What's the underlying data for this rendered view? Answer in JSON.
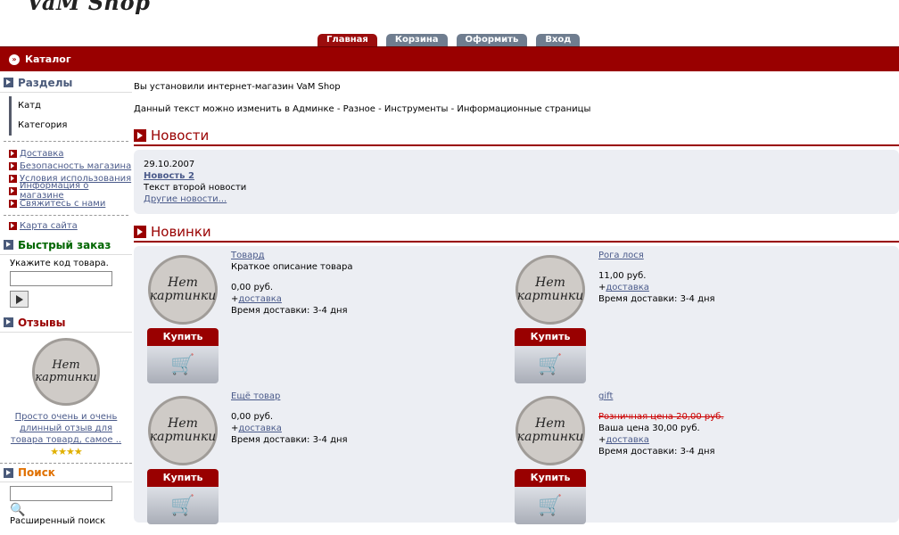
{
  "logo": "VaM Shop",
  "tabs": [
    {
      "label": "Главная",
      "active": true
    },
    {
      "label": "Корзина",
      "active": false
    },
    {
      "label": "Оформить",
      "active": false
    },
    {
      "label": "Вход",
      "active": false
    }
  ],
  "topbar": {
    "catalog": "Каталог"
  },
  "sidebar": {
    "sections_title": "Разделы",
    "sections": [
      "Катд",
      "Категория"
    ],
    "info_links": [
      "Доставка",
      "Безопасность магазина",
      "Условия использования",
      "Информация о магазине",
      "Свяжитесь с нами"
    ],
    "sitemap": "Карта сайта",
    "quick_order_title": "Быстрый заказ",
    "quick_order_label": "Укажите код товара.",
    "reviews_title": "Отзывы",
    "review_text": "Просто очень и очень длинный отзыв для товара товард, самое ..",
    "search_title": "Поиск",
    "advanced_search": "Расширенный поиск"
  },
  "no_picture": "Нет картинки",
  "main": {
    "intro1": "Вы установили интернет-магазин VaM Shop",
    "intro2": "Данный текст можно изменить в Админке - Разное - Инструменты - Информационные страницы",
    "news_title": "Новости",
    "news_date": "29.10.2007",
    "news_headline": "Новость 2",
    "news_text": "Текст второй новости",
    "news_more": "Другие новости...",
    "new_title": "Новинки",
    "buy_label": "Купить",
    "delivery_link": "доставка",
    "products": [
      {
        "name": "Товард",
        "desc": "Краткое описание товара",
        "price": "0,00 руб.",
        "delivery_time": "Время доставки:  3-4 дня"
      },
      {
        "name": "Рога лося",
        "price": "11,00 руб.",
        "delivery_time": "Время доставки:  3-4 дня"
      },
      {
        "name": "Ещё товар",
        "price": "0,00 руб.",
        "delivery_time": "Время доставки:  3-4 дня"
      },
      {
        "name": "gift",
        "old_price": "Розничная цена 20,00 руб.",
        "price": "Ваша цена 30,00 руб.",
        "delivery_time": "Время доставки:  3-4 дня"
      }
    ]
  },
  "colors": {
    "brand": "#990000",
    "tab_inactive": "#6f7d8f",
    "panel_bg": "#eceef3"
  }
}
